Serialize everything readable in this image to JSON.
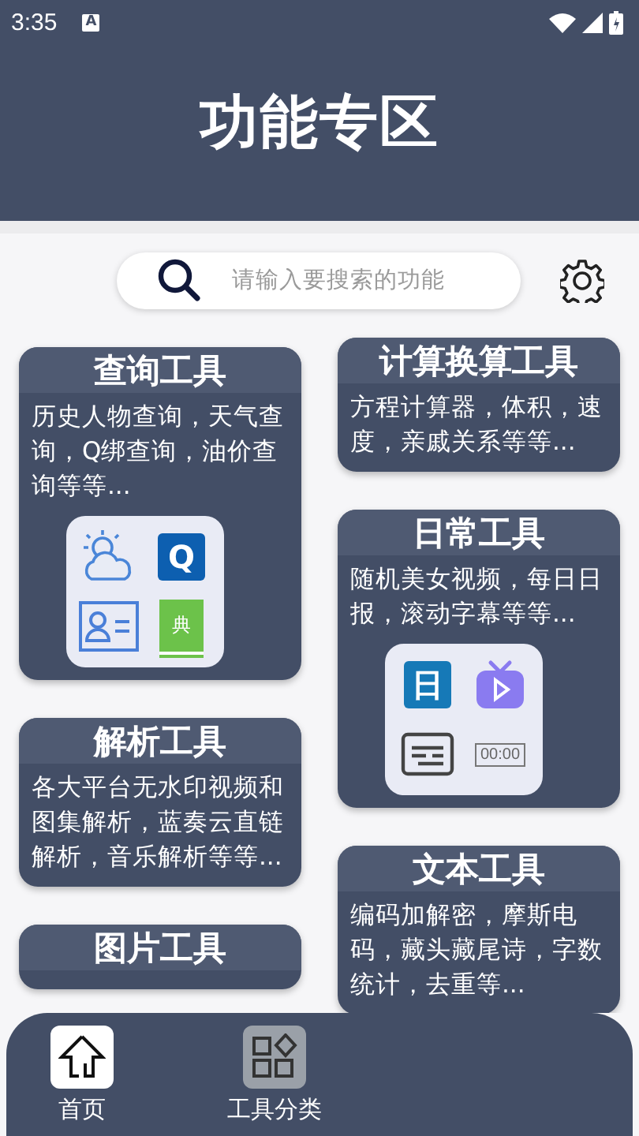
{
  "status_bar": {
    "time": "3:35",
    "notification": "A"
  },
  "header": {
    "title": "功能专区"
  },
  "search": {
    "placeholder": "请输入要搜索的功能"
  },
  "left_column": [
    {
      "title": "查询工具",
      "description": "历史人物查询，天气查询，Q绑查询，油价查询等等...",
      "icons": [
        {
          "kind": "weather"
        },
        {
          "kind": "tile",
          "label": "Q",
          "color": "#0d5fb0"
        },
        {
          "kind": "contact"
        },
        {
          "kind": "book",
          "label": "典",
          "color": "#6cc24a"
        }
      ]
    },
    {
      "title": "解析工具",
      "description": "各大平台无水印视频和图集解析，蓝奏云直链解析，音乐解析等等..."
    },
    {
      "title": "图片工具"
    }
  ],
  "right_column": [
    {
      "title": "计算换算工具",
      "description": "方程计算器，体积，速度，亲戚关系等等..."
    },
    {
      "title": "日常工具",
      "description": "随机美女视频，每日日报，滚动字幕等等...",
      "icons": [
        {
          "kind": "tile",
          "label": "日",
          "color": "#1679b7"
        },
        {
          "kind": "tv"
        },
        {
          "kind": "subtitle"
        },
        {
          "kind": "clock_text",
          "label": "00:00"
        }
      ]
    },
    {
      "title": "文本工具",
      "description": "编码加解密，摩斯电码，藏头藏尾诗，字数统计，去重等..."
    }
  ],
  "bottom_nav": [
    {
      "label": "首页",
      "kind": "home",
      "selected": false
    },
    {
      "label": "工具分类",
      "kind": "grid",
      "selected": true
    }
  ]
}
